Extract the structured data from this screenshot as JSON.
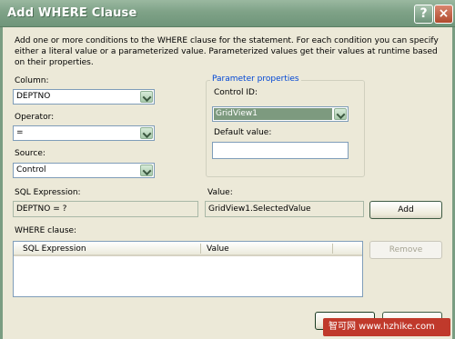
{
  "window": {
    "title": "Add WHERE Clause",
    "help_glyph": "?",
    "close_glyph": "×"
  },
  "description": "Add one or more conditions to the WHERE clause for the statement. For each condition you can specify either a literal value or a parameterized value. Parameterized values get their values at runtime based on their properties.",
  "column": {
    "label": "Column:",
    "value": "DEPTNO"
  },
  "operator": {
    "label": "Operator:",
    "value": "="
  },
  "source": {
    "label": "Source:",
    "value": "Control"
  },
  "parameter_properties": {
    "title": "Parameter properties",
    "control_id_label": "Control ID:",
    "control_id_value": "GridView1",
    "default_value_label": "Default value:",
    "default_value": ""
  },
  "sql_expression": {
    "label": "SQL Expression:",
    "value": "DEPTNO = ?"
  },
  "value_field": {
    "label": "Value:",
    "value": "GridView1.SelectedValue"
  },
  "buttons": {
    "add": "Add",
    "remove": "Remove"
  },
  "where_clause": {
    "label": "WHERE clause:",
    "columns": [
      "SQL Expression",
      "Value"
    ]
  },
  "watermark": "智可网  www.hzhike.com",
  "colors": {
    "titlebar": "#7fa287",
    "accent": "#0046d5",
    "selection": "#7d9a7f"
  },
  "icons": [
    "help-icon",
    "close-icon",
    "dropdown-arrow-icon"
  ]
}
